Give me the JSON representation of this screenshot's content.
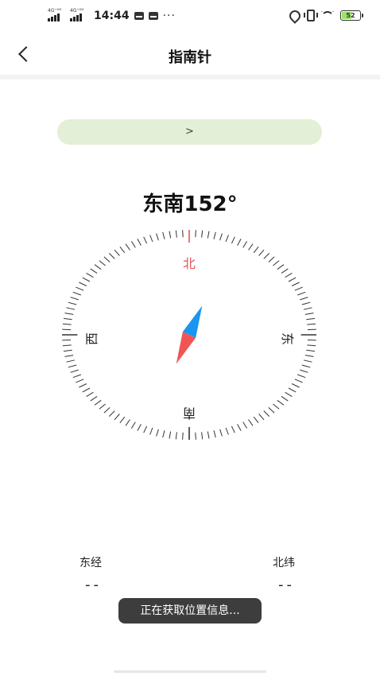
{
  "status_bar": {
    "signal_1_label": "4G⁺ᴴᴰ",
    "signal_2_label": "4G⁺ᴴᴰ",
    "time": "14:44",
    "more": "···",
    "battery": "52"
  },
  "header": {
    "title": "指南针"
  },
  "banner": {
    "text": ">"
  },
  "compass": {
    "direction_text": "东南152°",
    "heading_degrees": 152,
    "north": "北",
    "east": "东",
    "south": "南",
    "west": "西",
    "north_color": "#e35555",
    "needle_blue": "#1a95f0",
    "needle_red": "#f05555"
  },
  "coordinates": {
    "longitude_label": "东经",
    "longitude_value": "--",
    "latitude_label": "北纬",
    "latitude_value": "--"
  },
  "toast": {
    "text": "正在获取位置信息..."
  },
  "colors": {
    "banner_bg": "#e3efd6",
    "toast_bg": "#3d3d3d"
  }
}
